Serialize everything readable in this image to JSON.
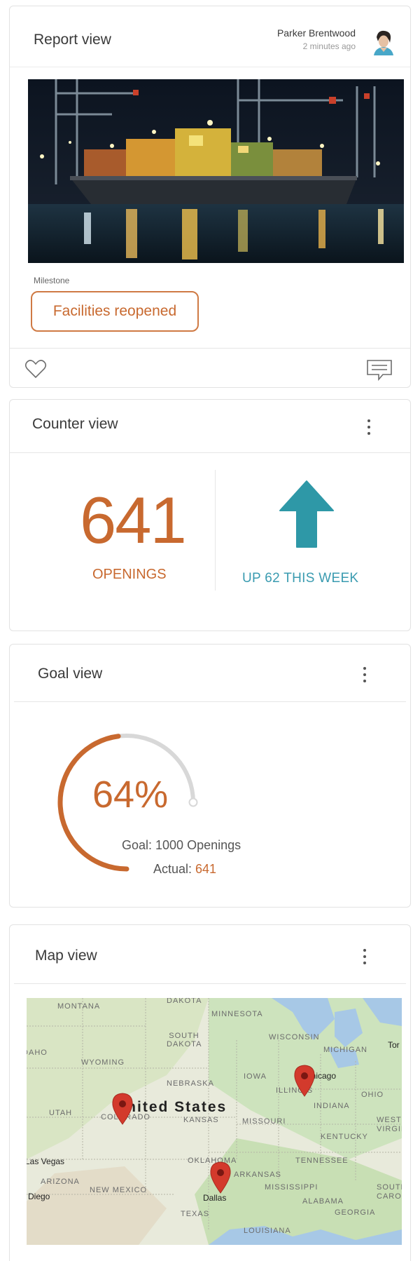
{
  "report": {
    "title": "Report view",
    "author": "Parker Brentwood",
    "time": "2 minutes ago",
    "milestone_label": "Milestone",
    "milestone_value": "Facilities reopened"
  },
  "counter": {
    "title": "Counter view",
    "value": "641",
    "unit": "OPENINGS",
    "change": "UP 62 THIS WEEK"
  },
  "goal": {
    "title": "Goal view",
    "percent": "64%",
    "progress": 0.64,
    "target": "Goal: 1000 Openings",
    "actual_label": "Actual: ",
    "actual_value": "641"
  },
  "map": {
    "title": "Map view",
    "country": "United States",
    "states": [
      "MONTANA",
      "DAKOTA",
      "MINNESOTA",
      "SOUTH DAKOTA",
      "WISCONSIN",
      "MICHIGAN",
      "IDAHO",
      "WYOMING",
      "NEBRASKA",
      "IOWA",
      "ILLINOIS",
      "OHIO",
      "UTAH",
      "COLORADO",
      "KANSAS",
      "MISSOURI",
      "INDIANA",
      "WEST VIRGINIA",
      "KENTUCKY",
      "OKLAHOMA",
      "TENNESSEE",
      "ARKANSAS",
      "ARIZONA",
      "NEW MEXICO",
      "MISSISSIPPI",
      "ALABAMA",
      "GEORGIA",
      "SOUTH CAROLINA",
      "TEXAS",
      "LOUISIANA"
    ],
    "cities": [
      "Las Vegas",
      "Diego",
      "Dallas",
      "Chicago",
      "Tor"
    ],
    "pin_color": "#d33a2c"
  },
  "colors": {
    "accent_orange": "#c8692f",
    "accent_teal": "#2e98a7",
    "gauge_track": "#d8d8d8"
  }
}
